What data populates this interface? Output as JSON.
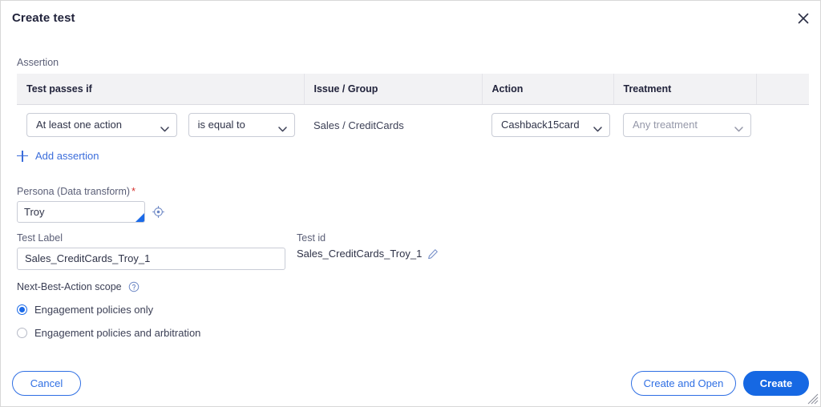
{
  "dialog": {
    "title": "Create test",
    "close_icon": "close-icon"
  },
  "assertion": {
    "section_label": "Assertion",
    "columns": [
      "Test passes if",
      "Issue / Group",
      "Action",
      "Treatment",
      ""
    ],
    "row": {
      "passes_if": "At least one action",
      "comparator": "is equal to",
      "issue_group": "Sales / CreditCards",
      "action": "Cashback15card",
      "treatment_placeholder": "Any treatment",
      "treatment_value": ""
    },
    "add_assertion_label": "Add assertion",
    "add_assertion_icon": "plus-icon"
  },
  "persona": {
    "label": "Persona (Data transform)",
    "required_marker": "*",
    "value": "Troy",
    "target_icon": "crosshair-icon"
  },
  "test_label": {
    "label": "Test Label",
    "value": "Sales_CreditCards_Troy_1"
  },
  "test_id": {
    "label": "Test id",
    "value": "Sales_CreditCards_Troy_1",
    "edit_icon": "pencil-icon"
  },
  "nba_scope": {
    "title": "Next-Best-Action scope",
    "help_icon": "help-circle-icon",
    "options": [
      {
        "label": "Engagement policies only",
        "selected": true
      },
      {
        "label": "Engagement policies and arbitration",
        "selected": false
      }
    ]
  },
  "footer": {
    "cancel_label": "Cancel",
    "create_open_label": "Create and Open",
    "create_label": "Create"
  },
  "colors": {
    "primary_blue": "#1668e3",
    "link_blue": "#3b6ddb",
    "header_bg": "#f2f2f4",
    "required_red": "#d5322f",
    "text_dark": "#22243c",
    "text_muted": "#5b5f77"
  },
  "resize_grip_icon": "resize-grip-icon"
}
